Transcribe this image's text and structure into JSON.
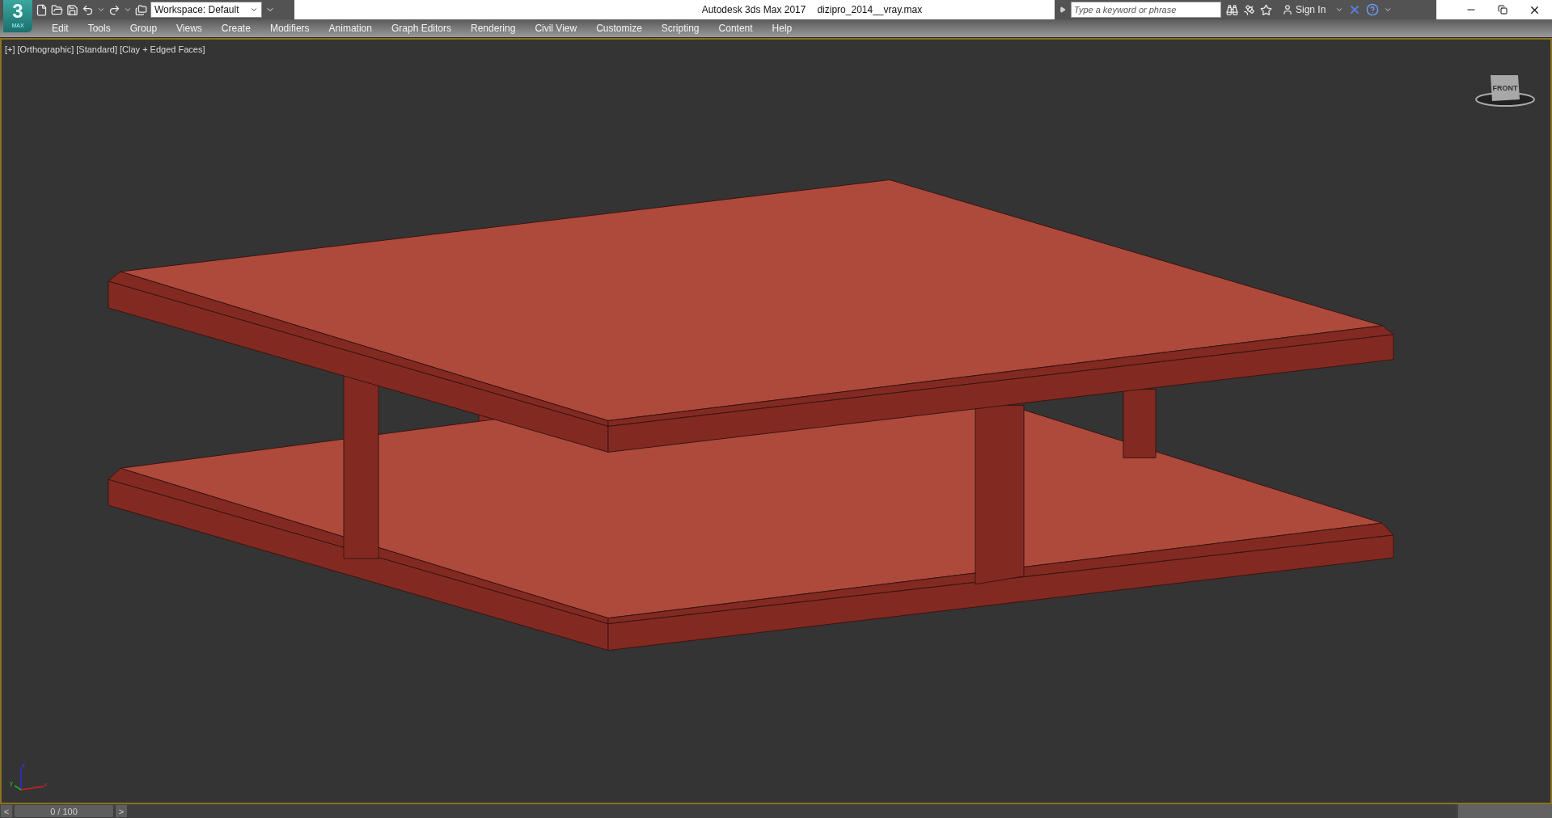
{
  "window": {
    "app_title": "Autodesk 3ds Max 2017",
    "file_name": "dizipro_2014__vray.max"
  },
  "logo": {
    "digit": "3",
    "sub": "MAX"
  },
  "workspace": {
    "value": "Workspace: Default"
  },
  "search": {
    "placeholder": "Type a keyword or phrase"
  },
  "sign_in": "Sign In",
  "menu": [
    "Edit",
    "Tools",
    "Group",
    "Views",
    "Create",
    "Modifiers",
    "Animation",
    "Graph Editors",
    "Rendering",
    "Civil View",
    "Customize",
    "Scripting",
    "Content",
    "Help"
  ],
  "viewport": {
    "labels": [
      "[+]",
      "[Orthographic]",
      "[Standard]",
      "[Clay + Edged Faces]"
    ],
    "view_cube": "FRONT",
    "axes": {
      "z": "z",
      "y": "y",
      "x": "x"
    }
  },
  "timeline": {
    "prev": "<",
    "position": "0 / 100",
    "level": 0,
    "next": ">"
  }
}
